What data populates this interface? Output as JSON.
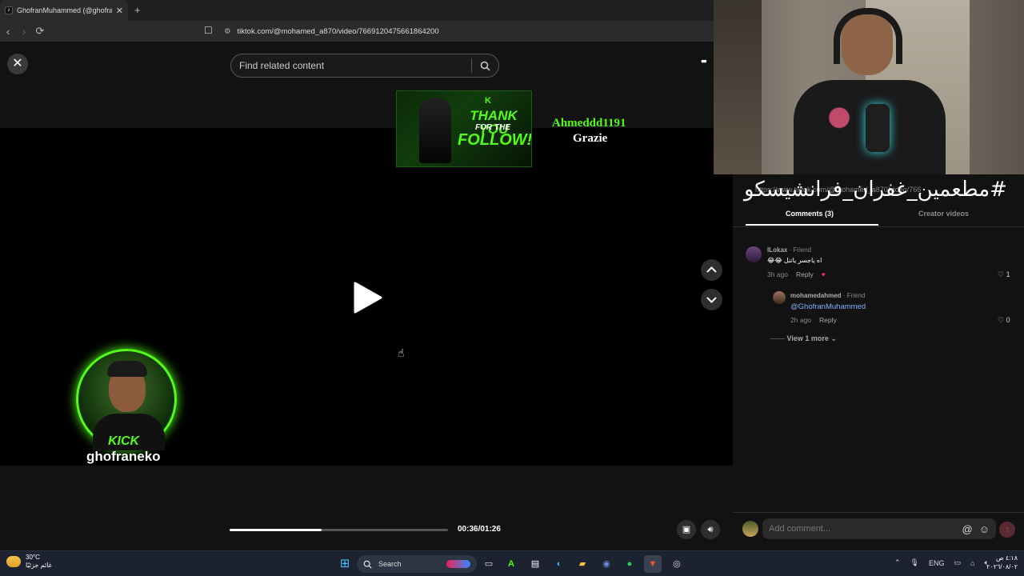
{
  "browser": {
    "tab_title": "GhofranMuhammed (@ghofran…",
    "tab_favicon": "tiktok-icon",
    "new_tab_symbol": "+",
    "url": "tiktok.com/@mohamed_a870/video/7669120475661864200"
  },
  "player": {
    "search_placeholder": "Find related content",
    "time": "00:36/01:26",
    "progress_fraction": 0.42
  },
  "alert": {
    "follower": "Ahmeddd1191",
    "message": "Grazie",
    "card_k": "K",
    "card_line1": "THANK YOU",
    "card_line2": "FOR THE",
    "card_line3": "FOLLOW!"
  },
  "kick": {
    "brand": "KICK",
    "handle": "ghofraneko"
  },
  "overlay": {
    "hashtag": "مطعمين_غفران_فرانشيسكو#",
    "url_fragment": "https://www.tiktok.com/@mohamed_a870/video/766"
  },
  "tabs": {
    "comments": "Comments (3)",
    "creator": "Creator videos"
  },
  "comments": [
    {
      "name": "lLokax",
      "friend": " · Friend",
      "text": "😂😂 اه ياجسر ياتنل",
      "time": "3h ago",
      "reply": "Reply",
      "likes": "1"
    },
    {
      "name": "mohamedahmed",
      "friend": " · Friend",
      "text": "@GhofranMuhammed",
      "time": "2h ago",
      "reply": "Reply",
      "likes": "0"
    }
  ],
  "view_more": "View 1 more",
  "add_comment_placeholder": "Add comment...",
  "taskbar": {
    "temp": "30°C",
    "weather_desc": "غائم جزئيًا",
    "search": "Search",
    "lang": "ENG",
    "time": "٤:١٨ ص",
    "date": "٢٠٢٦/٠٨/٠٢"
  },
  "colors": {
    "kick_green": "#53fc18",
    "accent_blue": "#7fb3ff"
  }
}
